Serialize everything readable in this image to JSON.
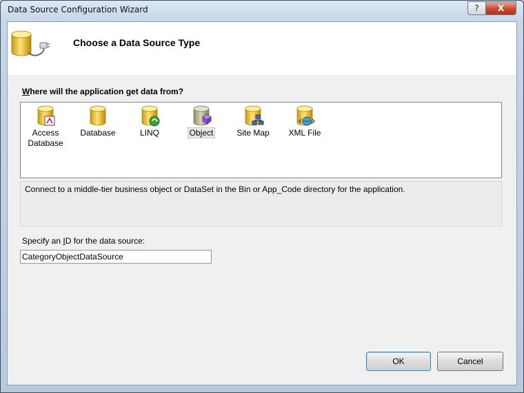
{
  "window": {
    "title": "Data Source Configuration Wizard",
    "help_label": "?",
    "close_label": "X"
  },
  "header": {
    "title": "Choose a Data Source Type",
    "icon": "database-connect-icon"
  },
  "prompt": {
    "prefix": "W",
    "rest": "here will the application get data from?"
  },
  "types": [
    {
      "name": "access-database",
      "line1": "Access",
      "line2": "Database",
      "icon": "access-db-icon",
      "selected": false
    },
    {
      "name": "database",
      "line1": "Database",
      "line2": "",
      "icon": "database-icon",
      "selected": false
    },
    {
      "name": "linq",
      "line1": "LINQ",
      "line2": "",
      "icon": "linq-icon",
      "selected": false
    },
    {
      "name": "object",
      "line1": "Object",
      "line2": "",
      "icon": "object-icon",
      "selected": true
    },
    {
      "name": "site-map",
      "line1": "Site Map",
      "line2": "",
      "icon": "sitemap-icon",
      "selected": false
    },
    {
      "name": "xml-file",
      "line1": "XML File",
      "line2": "",
      "icon": "xml-icon",
      "selected": false
    }
  ],
  "description": "Connect to a middle-tier business object or DataSet in the Bin or App_Code directory for the application.",
  "id_section": {
    "label_prefix": "Specify an ",
    "label_underlined": "I",
    "label_suffix": "D for the data source:",
    "value": "CategoryObjectDataSource"
  },
  "buttons": {
    "ok": "OK",
    "cancel": "Cancel"
  }
}
